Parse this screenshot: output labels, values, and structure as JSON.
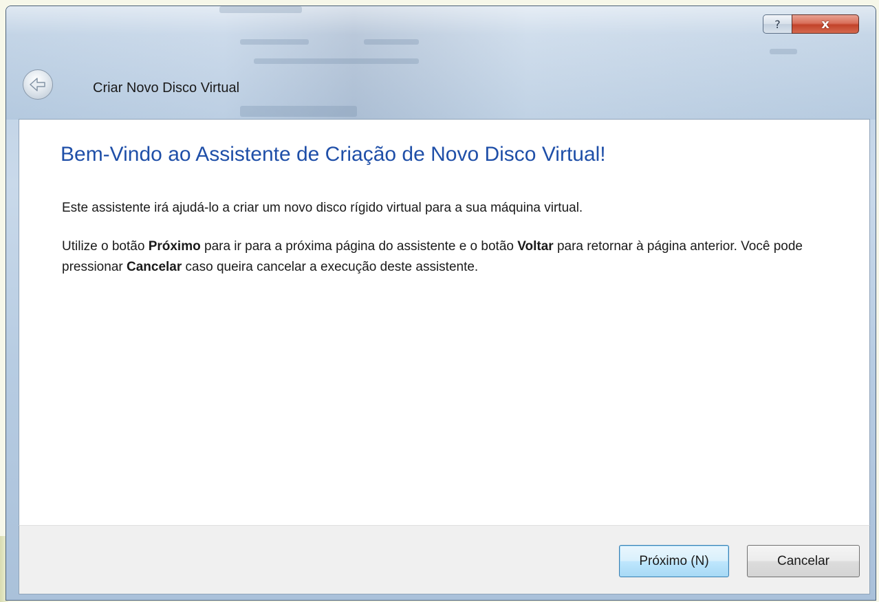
{
  "window": {
    "title": "Criar Novo Disco Virtual",
    "help_symbol": "?",
    "close_symbol": "x"
  },
  "icons": {
    "back": "back-arrow-icon",
    "help": "question-mark-icon",
    "close": "close-icon"
  },
  "content": {
    "heading": "Bem-Vindo ao Assistente de Criação de Novo Disco Virtual!",
    "paragraph1": "Este assistente irá ajudá-lo a criar um novo disco rígido virtual para a sua máquina virtual.",
    "paragraph2": {
      "part1": "Utilize o botão ",
      "bold1": "Próximo",
      "part2": " para ir para a próxima página do assistente e o botão ",
      "bold2": "Voltar",
      "part3": " para retornar à página anterior. Você pode pressionar ",
      "bold3": "Cancelar",
      "part4": " caso queira cancelar a execução deste assistente."
    }
  },
  "footer": {
    "next_label": "Próximo (N)",
    "cancel_label": "Cancelar"
  },
  "colors": {
    "heading": "#1f4fa8",
    "close_button": "#c2432a",
    "default_button_border": "#3c7fb1"
  }
}
